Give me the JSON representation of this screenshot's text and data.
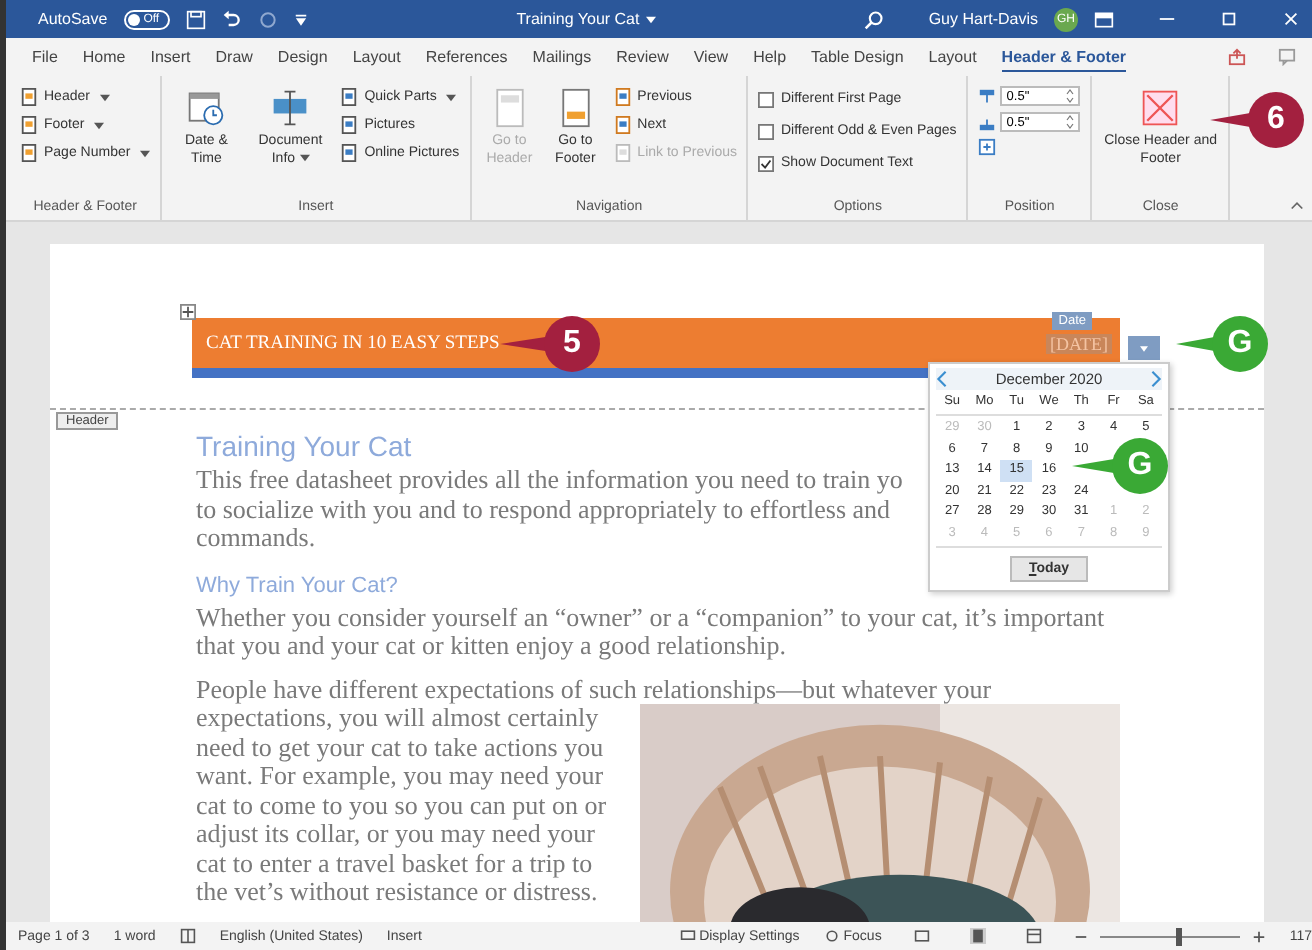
{
  "title_bar": {
    "autosave_label": "AutoSave",
    "autosave_state": "Off",
    "autosave_on": false,
    "document_title": "Training Your Cat",
    "user_name": "Guy Hart-Davis",
    "user_initials": "GH"
  },
  "tabs": [
    {
      "label": "File",
      "selected": false
    },
    {
      "label": "Home",
      "selected": false
    },
    {
      "label": "Insert",
      "selected": false
    },
    {
      "label": "Draw",
      "selected": false
    },
    {
      "label": "Design",
      "selected": false
    },
    {
      "label": "Layout",
      "selected": false
    },
    {
      "label": "References",
      "selected": false
    },
    {
      "label": "Mailings",
      "selected": false
    },
    {
      "label": "Review",
      "selected": false
    },
    {
      "label": "View",
      "selected": false
    },
    {
      "label": "Help",
      "selected": false
    },
    {
      "label": "Table Design",
      "selected": false
    },
    {
      "label": "Layout",
      "selected": false
    },
    {
      "label": "Header & Footer",
      "selected": true
    }
  ],
  "ribbon": [
    {
      "label": "Header & Footer",
      "small": [
        {
          "label": "Header",
          "menu": true,
          "disabled": false
        },
        {
          "label": "Footer",
          "menu": true,
          "disabled": false
        },
        {
          "label": "Page Number",
          "menu": true,
          "disabled": false
        }
      ]
    },
    {
      "label": "Insert",
      "large": [
        {
          "label": "Date & Time",
          "menu": false,
          "disabled": false
        },
        {
          "label": "Document Info",
          "menu": true,
          "disabled": false
        }
      ],
      "small": [
        {
          "label": "Quick Parts",
          "menu": true,
          "disabled": false
        },
        {
          "label": "Pictures",
          "menu": false,
          "disabled": false
        },
        {
          "label": "Online Pictures",
          "menu": false,
          "disabled": false
        }
      ]
    },
    {
      "label": "Navigation",
      "large": [
        {
          "label": "Go to Header",
          "menu": false,
          "disabled": true
        },
        {
          "label": "Go to Footer",
          "menu": false,
          "disabled": false
        }
      ],
      "small": [
        {
          "label": "Previous",
          "menu": false,
          "disabled": false
        },
        {
          "label": "Next",
          "menu": false,
          "disabled": false
        },
        {
          "label": "Link to Previous",
          "menu": false,
          "disabled": true
        }
      ]
    },
    {
      "label": "Options",
      "checks": [
        {
          "label": "Different First Page",
          "checked": false
        },
        {
          "label": "Different Odd & Even Pages",
          "checked": false
        },
        {
          "label": "Show Document Text",
          "checked": true
        }
      ]
    },
    {
      "label": "Position",
      "spinners": [
        {
          "value": "0.5\""
        },
        {
          "value": "0.5\""
        }
      ]
    },
    {
      "label": "Close",
      "large": [
        {
          "label": "Close Header and Footer",
          "menu": false,
          "disabled": false
        }
      ]
    }
  ],
  "document": {
    "header": {
      "tab_label": "Header",
      "text": "CAT TRAINING IN 10 EASY STEPS",
      "date_tag": "Date",
      "date_field": "[DATE]"
    },
    "calendar": {
      "month": "December 2020",
      "weekdays": [
        "Su",
        "Mo",
        "Tu",
        "We",
        "Th",
        "Fr",
        "Sa"
      ],
      "weeks": [
        [
          {
            "d": "29",
            "other": true,
            "selected": false
          },
          {
            "d": "30",
            "other": true,
            "selected": false
          },
          {
            "d": "1",
            "other": false,
            "selected": false
          },
          {
            "d": "2",
            "other": false,
            "selected": false
          },
          {
            "d": "3",
            "other": false,
            "selected": false
          },
          {
            "d": "4",
            "other": false,
            "selected": false
          },
          {
            "d": "5",
            "other": false,
            "selected": false
          }
        ],
        [
          {
            "d": "6",
            "other": false,
            "selected": false
          },
          {
            "d": "7",
            "other": false,
            "selected": false
          },
          {
            "d": "8",
            "other": false,
            "selected": false
          },
          {
            "d": "9",
            "other": false,
            "selected": false
          },
          {
            "d": "10",
            "other": false,
            "selected": false
          }
        ],
        [
          {
            "d": "13",
            "other": false,
            "selected": false
          },
          {
            "d": "14",
            "other": false,
            "selected": false
          },
          {
            "d": "15",
            "other": false,
            "selected": true
          },
          {
            "d": "16",
            "other": false,
            "selected": false
          }
        ],
        [
          {
            "d": "20",
            "other": false,
            "selected": false
          },
          {
            "d": "21",
            "other": false,
            "selected": false
          },
          {
            "d": "22",
            "other": false,
            "selected": false
          },
          {
            "d": "23",
            "other": false,
            "selected": false
          },
          {
            "d": "24",
            "other": false,
            "selected": false
          }
        ],
        [
          {
            "d": "27",
            "other": false,
            "selected": false
          },
          {
            "d": "28",
            "other": false,
            "selected": false
          },
          {
            "d": "29",
            "other": false,
            "selected": false
          },
          {
            "d": "30",
            "other": false,
            "selected": false
          },
          {
            "d": "31",
            "other": false,
            "selected": false
          },
          {
            "d": "1",
            "other": true,
            "selected": false
          },
          {
            "d": "2",
            "other": true,
            "selected": false
          }
        ],
        [
          {
            "d": "3",
            "other": true,
            "selected": false
          },
          {
            "d": "4",
            "other": true,
            "selected": false
          },
          {
            "d": "5",
            "other": true,
            "selected": false
          },
          {
            "d": "6",
            "other": true,
            "selected": false
          },
          {
            "d": "7",
            "other": true,
            "selected": false
          },
          {
            "d": "8",
            "other": true,
            "selected": false
          },
          {
            "d": "9",
            "other": true,
            "selected": false
          }
        ]
      ],
      "today_button": "Today"
    },
    "body": [
      {
        "kind": "title",
        "text": "Training Your Cat"
      },
      {
        "kind": "lines",
        "lines": [
          "This free datasheet provides all the information you need to train yo",
          "to socialize with you and to respond appropriately to effortless and",
          "commands."
        ]
      },
      {
        "kind": "heading",
        "text": "Why Train Your Cat?"
      },
      {
        "kind": "paragraph",
        "text": "Whether you consider yourself an “owner” or a “companion” to your cat, it’s important that you and your cat or kitten enjoy a good relationship."
      },
      {
        "kind": "figure_paragraph",
        "lead": "People have different expectations of such relationships—but whatever your",
        "text": "expectations, you will almost certainly need to get your cat to take actions you want. For example, you may need your cat to come to you so you can put on or adjust its collar, or you may need your cat to enter a travel basket for a trip to the vet’s without resistance or distress."
      }
    ]
  },
  "callouts": [
    {
      "label": "5"
    },
    {
      "label": "6"
    },
    {
      "label": "G"
    },
    {
      "label": "G"
    }
  ],
  "status_bar": {
    "left": [
      "Page 1 of 3",
      "1 word",
      "English (United States)",
      "Insert"
    ],
    "display_settings": "Display Settings",
    "focus": "Focus",
    "zoom": {
      "level": 0.55,
      "reading": "117"
    }
  }
}
